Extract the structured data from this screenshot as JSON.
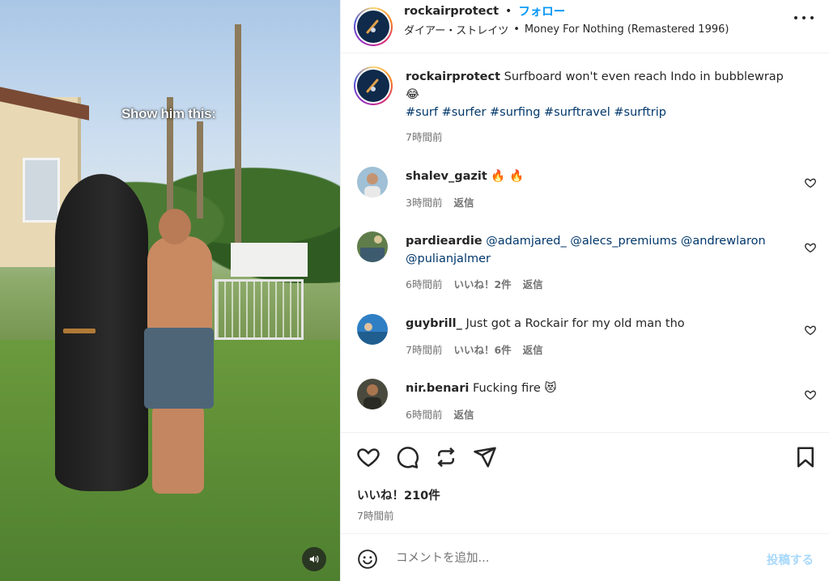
{
  "media": {
    "overlay_text": "Show him this:",
    "mute_icon": "speaker-icon"
  },
  "header": {
    "username": "rockairprotect",
    "separator": "•",
    "follow_label": "フォロー",
    "audio_artist": "ダイアー・ストレイツ",
    "audio_separator": "•",
    "audio_title": "Money For Nothing (Remastered 1996)",
    "more_icon": "more-horizontal-icon"
  },
  "caption": {
    "username": "rockairprotect",
    "text": "Surfboard won't even reach Indo in bubblewrap",
    "emoji": "😂",
    "hashtags": "#surf #surfer #surfing #surftravel #surftrip",
    "time": "7時間前"
  },
  "comments": [
    {
      "username": "shalev_gazit",
      "text": "🔥 🔥",
      "time": "3時間前",
      "likes": "",
      "reply": "返信"
    },
    {
      "username": "pardieardie",
      "text": "",
      "mentions_line1": "@adamjared_ @alecs_premiums @andrewlaron",
      "mentions_line2": "@pulianjalmer",
      "time": "6時間前",
      "likes": "いいね！2件",
      "reply": "返信"
    },
    {
      "username": "guybrill_",
      "text": "Just got a Rockair for my old man tho",
      "time": "7時間前",
      "likes": "いいね！6件",
      "reply": "返信"
    },
    {
      "username": "nir.benari",
      "text": "Fucking fire 😻",
      "time": "6時間前",
      "likes": "",
      "reply": "返信"
    }
  ],
  "actions": {
    "like_icon": "heart-icon",
    "comment_icon": "comment-icon",
    "repost_icon": "repost-icon",
    "share_icon": "send-icon",
    "save_icon": "bookmark-icon",
    "likes_count": "いいね！210件",
    "time_ago": "7時間前"
  },
  "composer": {
    "emoji_icon": "smiley-icon",
    "placeholder": "コメントを追加...",
    "post_label": "投稿する"
  },
  "colors": {
    "link_blue": "#0095f6",
    "mention_blue": "#00376b",
    "muted_gray": "#737373",
    "post_disabled": "#a7d8fb"
  }
}
